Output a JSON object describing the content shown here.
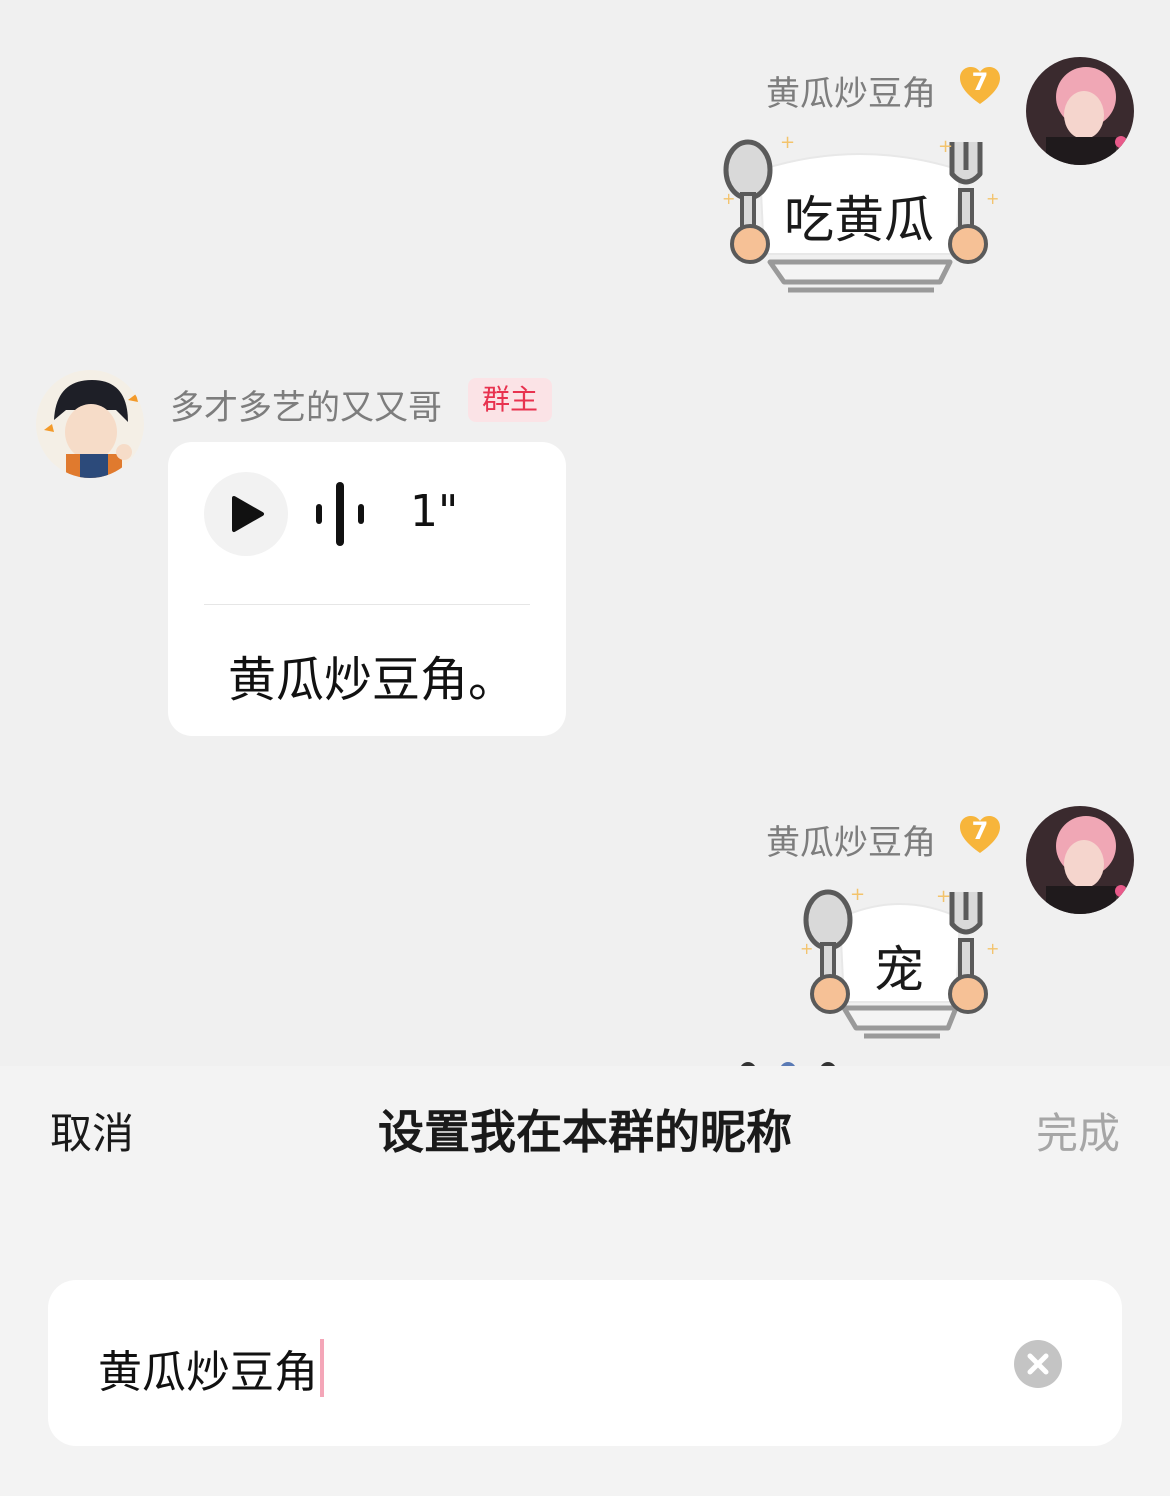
{
  "messages": [
    {
      "sender": "黄瓜炒豆角",
      "level": "7",
      "side": "right",
      "type": "sticker",
      "sticker_text": "吃黄瓜"
    },
    {
      "sender": "多才多艺的又又哥",
      "role_badge": "群主",
      "side": "left",
      "type": "voice",
      "duration": "1\"",
      "transcript": "黄瓜炒豆角。"
    },
    {
      "sender": "黄瓜炒豆角",
      "level": "7",
      "side": "right",
      "type": "sticker",
      "sticker_text": "宠"
    }
  ],
  "sheet": {
    "cancel_label": "取消",
    "title": "设置我在本群的昵称",
    "done_label": "完成",
    "nickname_value": "黄瓜炒豆角"
  },
  "colors": {
    "background": "#f0f0f0",
    "owner_badge_bg": "#fbe3e6",
    "owner_badge_text": "#e8324f",
    "level_badge": "#f7b53b",
    "caret": "#f4a6b8",
    "done_disabled": "#a6a6a6"
  },
  "icons": {
    "play": "play-icon",
    "voice_wave": "sound-wave-icon",
    "clear": "clear-input-icon",
    "level": "heart-level-icon"
  }
}
